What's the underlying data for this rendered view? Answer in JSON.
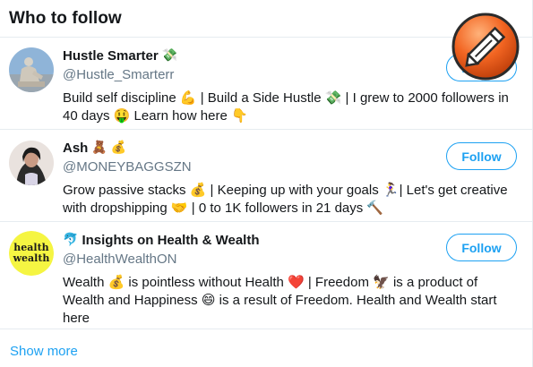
{
  "widget": {
    "title": "Who to follow",
    "show_more_label": "Show more",
    "accent_color": "#1da1f2"
  },
  "users": [
    {
      "name": "Hustle Smarter",
      "name_emojis": [
        "💸"
      ],
      "handle": "@Hustle_Smarterr",
      "bio": "Build self discipline 💪 | Build a Side Hustle 💸 | I grew to 2000 followers in 40 days 🤑 Learn how here 👇",
      "follow_label": "Follow",
      "avatar_icon": "statue-avatar-icon"
    },
    {
      "name": "Ash",
      "name_emojis": [
        "🧸",
        "💰"
      ],
      "handle": "@MONEYBAGGSZN",
      "bio": "Grow passive stacks 💰 | Keeping up with your goals 🏃‍♀️| Let's get creative with dropshipping 🤝 | 0 to 1K followers in 21 days 🔨",
      "follow_label": "Follow",
      "avatar_icon": "person-photo-avatar-icon"
    },
    {
      "name": "Insights on Health & Wealth",
      "name_prefix_emoji": "🐬",
      "handle": "@HealthWealthON",
      "bio": "Wealth 💰 is pointless without Health ❤️ | Freedom 🦅 is a product of Wealth and Happiness 😄 is a result of Freedom. Health and Wealth start here",
      "follow_label": "Follow",
      "avatar_text_line1": "health",
      "avatar_text_line2": "wealth"
    }
  ],
  "overlay": {
    "icon": "pencil-edit-icon",
    "color": "#f26522"
  }
}
